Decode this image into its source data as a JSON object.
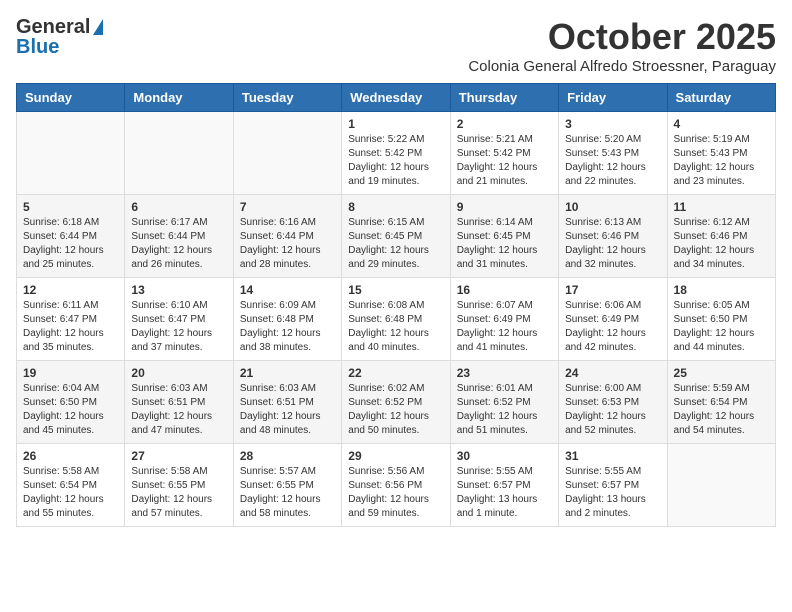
{
  "logo": {
    "general": "General",
    "blue": "Blue"
  },
  "header": {
    "month": "October 2025",
    "location": "Colonia General Alfredo Stroessner, Paraguay"
  },
  "weekdays": [
    "Sunday",
    "Monday",
    "Tuesday",
    "Wednesday",
    "Thursday",
    "Friday",
    "Saturday"
  ],
  "weeks": [
    [
      {
        "day": "",
        "sunrise": "",
        "sunset": "",
        "daylight": ""
      },
      {
        "day": "",
        "sunrise": "",
        "sunset": "",
        "daylight": ""
      },
      {
        "day": "",
        "sunrise": "",
        "sunset": "",
        "daylight": ""
      },
      {
        "day": "1",
        "sunrise": "Sunrise: 5:22 AM",
        "sunset": "Sunset: 5:42 PM",
        "daylight": "Daylight: 12 hours and 19 minutes."
      },
      {
        "day": "2",
        "sunrise": "Sunrise: 5:21 AM",
        "sunset": "Sunset: 5:42 PM",
        "daylight": "Daylight: 12 hours and 21 minutes."
      },
      {
        "day": "3",
        "sunrise": "Sunrise: 5:20 AM",
        "sunset": "Sunset: 5:43 PM",
        "daylight": "Daylight: 12 hours and 22 minutes."
      },
      {
        "day": "4",
        "sunrise": "Sunrise: 5:19 AM",
        "sunset": "Sunset: 5:43 PM",
        "daylight": "Daylight: 12 hours and 23 minutes."
      }
    ],
    [
      {
        "day": "5",
        "sunrise": "Sunrise: 6:18 AM",
        "sunset": "Sunset: 6:44 PM",
        "daylight": "Daylight: 12 hours and 25 minutes."
      },
      {
        "day": "6",
        "sunrise": "Sunrise: 6:17 AM",
        "sunset": "Sunset: 6:44 PM",
        "daylight": "Daylight: 12 hours and 26 minutes."
      },
      {
        "day": "7",
        "sunrise": "Sunrise: 6:16 AM",
        "sunset": "Sunset: 6:44 PM",
        "daylight": "Daylight: 12 hours and 28 minutes."
      },
      {
        "day": "8",
        "sunrise": "Sunrise: 6:15 AM",
        "sunset": "Sunset: 6:45 PM",
        "daylight": "Daylight: 12 hours and 29 minutes."
      },
      {
        "day": "9",
        "sunrise": "Sunrise: 6:14 AM",
        "sunset": "Sunset: 6:45 PM",
        "daylight": "Daylight: 12 hours and 31 minutes."
      },
      {
        "day": "10",
        "sunrise": "Sunrise: 6:13 AM",
        "sunset": "Sunset: 6:46 PM",
        "daylight": "Daylight: 12 hours and 32 minutes."
      },
      {
        "day": "11",
        "sunrise": "Sunrise: 6:12 AM",
        "sunset": "Sunset: 6:46 PM",
        "daylight": "Daylight: 12 hours and 34 minutes."
      }
    ],
    [
      {
        "day": "12",
        "sunrise": "Sunrise: 6:11 AM",
        "sunset": "Sunset: 6:47 PM",
        "daylight": "Daylight: 12 hours and 35 minutes."
      },
      {
        "day": "13",
        "sunrise": "Sunrise: 6:10 AM",
        "sunset": "Sunset: 6:47 PM",
        "daylight": "Daylight: 12 hours and 37 minutes."
      },
      {
        "day": "14",
        "sunrise": "Sunrise: 6:09 AM",
        "sunset": "Sunset: 6:48 PM",
        "daylight": "Daylight: 12 hours and 38 minutes."
      },
      {
        "day": "15",
        "sunrise": "Sunrise: 6:08 AM",
        "sunset": "Sunset: 6:48 PM",
        "daylight": "Daylight: 12 hours and 40 minutes."
      },
      {
        "day": "16",
        "sunrise": "Sunrise: 6:07 AM",
        "sunset": "Sunset: 6:49 PM",
        "daylight": "Daylight: 12 hours and 41 minutes."
      },
      {
        "day": "17",
        "sunrise": "Sunrise: 6:06 AM",
        "sunset": "Sunset: 6:49 PM",
        "daylight": "Daylight: 12 hours and 42 minutes."
      },
      {
        "day": "18",
        "sunrise": "Sunrise: 6:05 AM",
        "sunset": "Sunset: 6:50 PM",
        "daylight": "Daylight: 12 hours and 44 minutes."
      }
    ],
    [
      {
        "day": "19",
        "sunrise": "Sunrise: 6:04 AM",
        "sunset": "Sunset: 6:50 PM",
        "daylight": "Daylight: 12 hours and 45 minutes."
      },
      {
        "day": "20",
        "sunrise": "Sunrise: 6:03 AM",
        "sunset": "Sunset: 6:51 PM",
        "daylight": "Daylight: 12 hours and 47 minutes."
      },
      {
        "day": "21",
        "sunrise": "Sunrise: 6:03 AM",
        "sunset": "Sunset: 6:51 PM",
        "daylight": "Daylight: 12 hours and 48 minutes."
      },
      {
        "day": "22",
        "sunrise": "Sunrise: 6:02 AM",
        "sunset": "Sunset: 6:52 PM",
        "daylight": "Daylight: 12 hours and 50 minutes."
      },
      {
        "day": "23",
        "sunrise": "Sunrise: 6:01 AM",
        "sunset": "Sunset: 6:52 PM",
        "daylight": "Daylight: 12 hours and 51 minutes."
      },
      {
        "day": "24",
        "sunrise": "Sunrise: 6:00 AM",
        "sunset": "Sunset: 6:53 PM",
        "daylight": "Daylight: 12 hours and 52 minutes."
      },
      {
        "day": "25",
        "sunrise": "Sunrise: 5:59 AM",
        "sunset": "Sunset: 6:54 PM",
        "daylight": "Daylight: 12 hours and 54 minutes."
      }
    ],
    [
      {
        "day": "26",
        "sunrise": "Sunrise: 5:58 AM",
        "sunset": "Sunset: 6:54 PM",
        "daylight": "Daylight: 12 hours and 55 minutes."
      },
      {
        "day": "27",
        "sunrise": "Sunrise: 5:58 AM",
        "sunset": "Sunset: 6:55 PM",
        "daylight": "Daylight: 12 hours and 57 minutes."
      },
      {
        "day": "28",
        "sunrise": "Sunrise: 5:57 AM",
        "sunset": "Sunset: 6:55 PM",
        "daylight": "Daylight: 12 hours and 58 minutes."
      },
      {
        "day": "29",
        "sunrise": "Sunrise: 5:56 AM",
        "sunset": "Sunset: 6:56 PM",
        "daylight": "Daylight: 12 hours and 59 minutes."
      },
      {
        "day": "30",
        "sunrise": "Sunrise: 5:55 AM",
        "sunset": "Sunset: 6:57 PM",
        "daylight": "Daylight: 13 hours and 1 minute."
      },
      {
        "day": "31",
        "sunrise": "Sunrise: 5:55 AM",
        "sunset": "Sunset: 6:57 PM",
        "daylight": "Daylight: 13 hours and 2 minutes."
      },
      {
        "day": "",
        "sunrise": "",
        "sunset": "",
        "daylight": ""
      }
    ]
  ]
}
